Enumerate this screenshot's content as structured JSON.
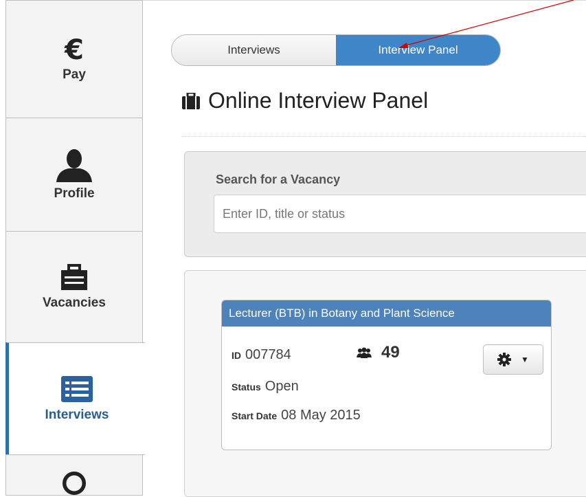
{
  "sidebar": {
    "items": [
      {
        "label": "Pay",
        "icon": "euro-icon"
      },
      {
        "label": "Profile",
        "icon": "user-icon"
      },
      {
        "label": "Vacancies",
        "icon": "briefcase-icon"
      },
      {
        "label": "Interviews",
        "icon": "list-icon",
        "active": true
      }
    ]
  },
  "tabs": {
    "interviews": "Interviews",
    "interview_panel": "Interview Panel",
    "active": "Interview Panel"
  },
  "page": {
    "title": "Online Interview Panel"
  },
  "search": {
    "label": "Search for a Vacancy",
    "placeholder": "Enter ID, title or status",
    "value": ""
  },
  "vacancy": {
    "title": "Lecturer (BTB) in Botany and Plant Science",
    "id_label": "ID",
    "id": "007784",
    "applicants": "49",
    "status_label": "Status",
    "status": "Open",
    "start_label": "Start Date",
    "start": "08 May 2015"
  },
  "colors": {
    "accent": "#3f86c9",
    "card_header": "#4d82bb",
    "active_sidebar": "#2f6faa",
    "annotation": "#d40000"
  }
}
